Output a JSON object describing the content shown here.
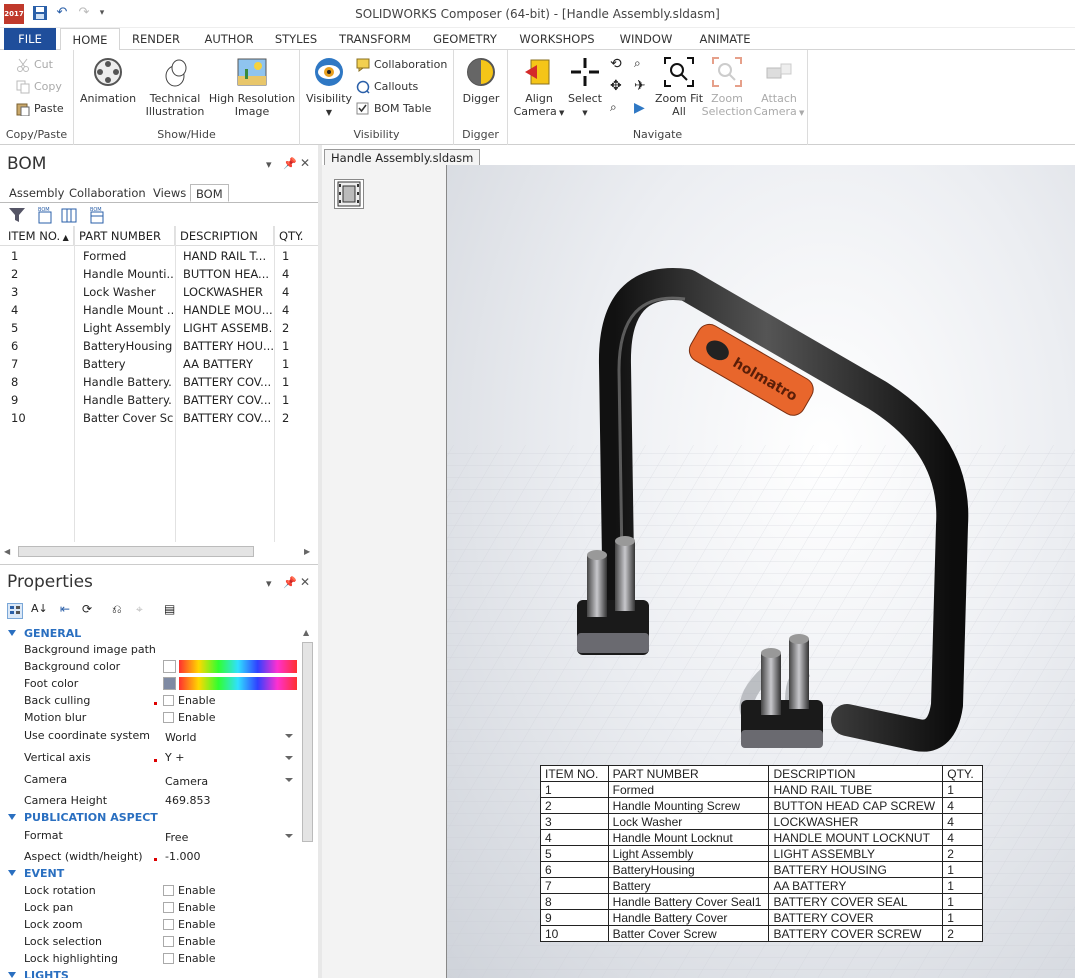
{
  "app": {
    "window_title": "SOLIDWORKS Composer (64-bit) - [Handle Assembly.sldasm]",
    "app_icon_label": "2017"
  },
  "ribbon_tabs": [
    "FILE",
    "HOME",
    "RENDER",
    "AUTHOR",
    "STYLES",
    "TRANSFORM",
    "GEOMETRY",
    "WORKSHOPS",
    "WINDOW",
    "ANIMATE"
  ],
  "ribbon": {
    "copy_paste": {
      "cut": "Cut",
      "copy": "Copy",
      "paste": "Paste",
      "label": "Copy/Paste"
    },
    "show_hide": {
      "animation": "Animation",
      "technical_illustration": "Technical Illustration",
      "high_resolution_image": "High Resolution Image",
      "label": "Show/Hide"
    },
    "visibility": {
      "visibility": "Visibility",
      "collaboration": "Collaboration",
      "callouts": "Callouts",
      "bom_table": "BOM Table",
      "label": "Visibility"
    },
    "digger": {
      "digger": "Digger",
      "label": "Digger"
    },
    "navigate": {
      "align_camera": "Align Camera",
      "select": "Select",
      "zoom_fit_all": "Zoom Fit All",
      "zoom_selection": "Zoom Selection",
      "attach_camera": "Attach Camera",
      "label": "Navigate"
    }
  },
  "bom_panel": {
    "title": "BOM",
    "tabs": [
      "Assembly",
      "Collaboration",
      "Views",
      "BOM"
    ],
    "columns": [
      "ITEM NO.",
      "PART NUMBER",
      "DESCRIPTION",
      "QTY."
    ],
    "rows": [
      [
        "1",
        "Formed",
        "HAND RAIL  T...",
        "1"
      ],
      [
        "2",
        "Handle Mounti...",
        "BUTTON HEA...",
        "4"
      ],
      [
        "3",
        "Lock Washer",
        "LOCKWASHER",
        "4"
      ],
      [
        "4",
        "Handle Mount ...",
        "HANDLE MOU...",
        "4"
      ],
      [
        "5",
        "Light Assembly",
        "LIGHT ASSEMB...",
        "2"
      ],
      [
        "6",
        "BatteryHousing",
        "BATTERY HOU...",
        "1"
      ],
      [
        "7",
        "Battery",
        "AA BATTERY",
        "1"
      ],
      [
        "8",
        "Handle Battery...",
        "BATTERY COV...",
        "1"
      ],
      [
        "9",
        "Handle Battery...",
        "BATTERY  COV...",
        "1"
      ],
      [
        "10",
        "Batter Cover Sc...",
        "BATTERY COV...",
        "2"
      ]
    ]
  },
  "properties_panel": {
    "title": "Properties",
    "general": "GENERAL",
    "background_image_path": "Background image path",
    "background_color": "Background color",
    "foot_color": "Foot color",
    "back_culling": "Back culling",
    "motion_blur": "Motion blur",
    "use_coordinate_system": "Use coordinate system",
    "use_coordinate_system_value": "World",
    "vertical_axis": "Vertical axis",
    "vertical_axis_value": "Y +",
    "camera": "Camera",
    "camera_value": "Camera",
    "camera_height": "Camera Height",
    "camera_height_value": "469.853",
    "publication_aspect": "PUBLICATION ASPECT",
    "format": "Format",
    "format_value": "Free",
    "aspect": "Aspect (width/height)",
    "aspect_value": "-1.000",
    "event": "EVENT",
    "lock_rotation": "Lock rotation",
    "lock_pan": "Lock pan",
    "lock_zoom": "Lock zoom",
    "lock_selection": "Lock selection",
    "lock_highlighting": "Lock highlighting",
    "lights": "LIGHTS",
    "enable": "Enable"
  },
  "document": {
    "tab": "Handle Assembly.sldasm",
    "logo_text": "holmatro"
  },
  "viewport_bom_table": {
    "columns": [
      "ITEM NO.",
      "PART NUMBER",
      "DESCRIPTION",
      "QTY."
    ],
    "rows": [
      [
        "1",
        "Formed",
        "HAND RAIL  TUBE",
        "1"
      ],
      [
        "2",
        "Handle Mounting Screw",
        "BUTTON HEAD CAP SCREW",
        "4"
      ],
      [
        "3",
        "Lock Washer",
        "LOCKWASHER",
        "4"
      ],
      [
        "4",
        "Handle Mount Locknut",
        "HANDLE MOUNT LOCKNUT",
        "4"
      ],
      [
        "5",
        "Light Assembly",
        "LIGHT ASSEMBLY",
        "2"
      ],
      [
        "6",
        "BatteryHousing",
        "BATTERY HOUSING",
        "1"
      ],
      [
        "7",
        "Battery",
        "AA BATTERY",
        "1"
      ],
      [
        "8",
        "Handle Battery Cover Seal1",
        "BATTERY COVER SEAL",
        "1"
      ],
      [
        "9",
        "Handle Battery Cover",
        "BATTERY  COVER",
        "1"
      ],
      [
        "10",
        "Batter Cover Screw",
        "BATTERY COVER SCREW",
        "2"
      ]
    ]
  },
  "colors": {
    "accent": "#1f4e9b",
    "section": "#2a6fc0",
    "logo_orange": "#e8662c"
  }
}
